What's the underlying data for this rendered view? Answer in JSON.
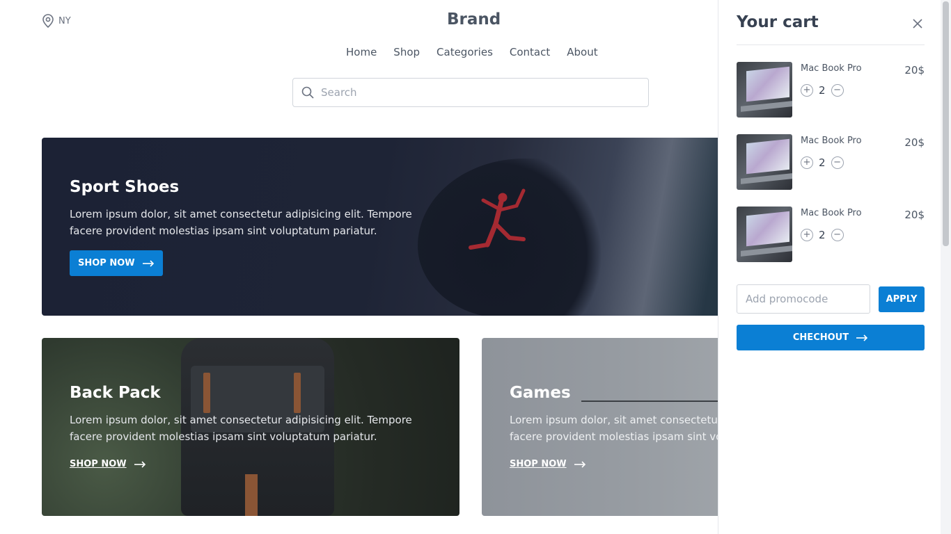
{
  "header": {
    "location": "NY",
    "brand": "Brand",
    "nav": [
      "Home",
      "Shop",
      "Categories",
      "Contact",
      "About"
    ],
    "search_placeholder": "Search"
  },
  "hero": {
    "title": "Sport Shoes",
    "description": "Lorem ipsum dolor, sit amet consectetur adipisicing elit. Tempore facere provident molestias ipsam sint voluptatum pariatur.",
    "button_label": "SHOP NOW"
  },
  "cards": [
    {
      "title": "Back Pack",
      "description": "Lorem ipsum dolor, sit amet consectetur adipisicing elit. Tempore facere provident molestias ipsam sint voluptatum pariatur.",
      "link_label": "SHOP NOW"
    },
    {
      "title": "Games",
      "description": "Lorem ipsum dolor, sit amet consectetur adipisicing elit. Tempore facere provident molestias ipsam sint voluptatum pariatur.",
      "link_label": "SHOP NOW"
    }
  ],
  "cart": {
    "title": "Your cart",
    "items": [
      {
        "name": "Mac Book Pro",
        "quantity": "2",
        "price": "20$"
      },
      {
        "name": "Mac Book Pro",
        "quantity": "2",
        "price": "20$"
      },
      {
        "name": "Mac Book Pro",
        "quantity": "2",
        "price": "20$"
      }
    ],
    "promo_placeholder": "Add promocode",
    "apply_label": "APPLY",
    "checkout_label": "CHECHOUT"
  },
  "colors": {
    "accent": "#0b7fd4",
    "text": "#374151"
  },
  "icons": [
    "location-pin-icon",
    "search-icon",
    "arrow-right-icon",
    "close-icon",
    "plus-circle-icon",
    "minus-circle-icon"
  ]
}
